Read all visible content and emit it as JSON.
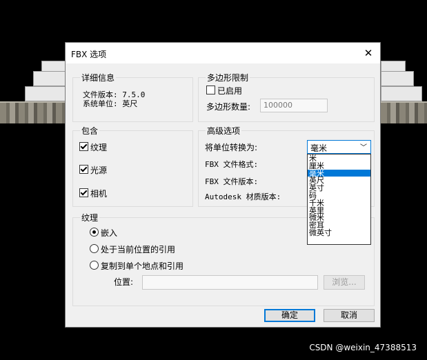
{
  "dialog": {
    "title": "FBX 选项",
    "close_glyph": "✕"
  },
  "details": {
    "legend": "详细信息",
    "file_version": "文件版本: 7.5.0",
    "system_units": "系统单位: 英尺"
  },
  "polygon_limit": {
    "legend": "多边形限制",
    "enable_label": "已启用",
    "enable_checked": false,
    "count_label": "多边形数量:",
    "count_value": "100000"
  },
  "include": {
    "legend": "包含",
    "texture_label": "纹理",
    "texture_checked": true,
    "light_label": "光源",
    "light_checked": true,
    "camera_label": "相机",
    "camera_checked": true
  },
  "advanced": {
    "legend": "高级选项",
    "convert_units_label": "将单位转换为:",
    "selected_unit": "毫米",
    "fbx_format_label": "FBX 文件格式:",
    "fbx_version_label": "FBX 文件版本:",
    "material_version_label": "Autodesk 材质版本:",
    "unit_options": [
      "米",
      "厘米",
      "毫米",
      "英尺",
      "英寸",
      "码",
      "千米",
      "英里",
      "微米",
      "密耳",
      "微英寸"
    ],
    "selected_index": 2
  },
  "texture": {
    "legend": "纹理",
    "embed_label": "嵌入",
    "ref_current_label": "处于当前位置的引用",
    "copy_single_label": "复制到单个地点和引用",
    "selected": "embed",
    "location_label": "位置:",
    "location_value": "",
    "browse_label": "浏览..."
  },
  "buttons": {
    "ok_label": "确定",
    "cancel_label": "取消"
  },
  "watermark": "CSDN @weixin_47388513",
  "colors": {
    "accent": "#0078d7",
    "dialog_bg": "#f0f0f0",
    "backdrop": "#000000"
  }
}
